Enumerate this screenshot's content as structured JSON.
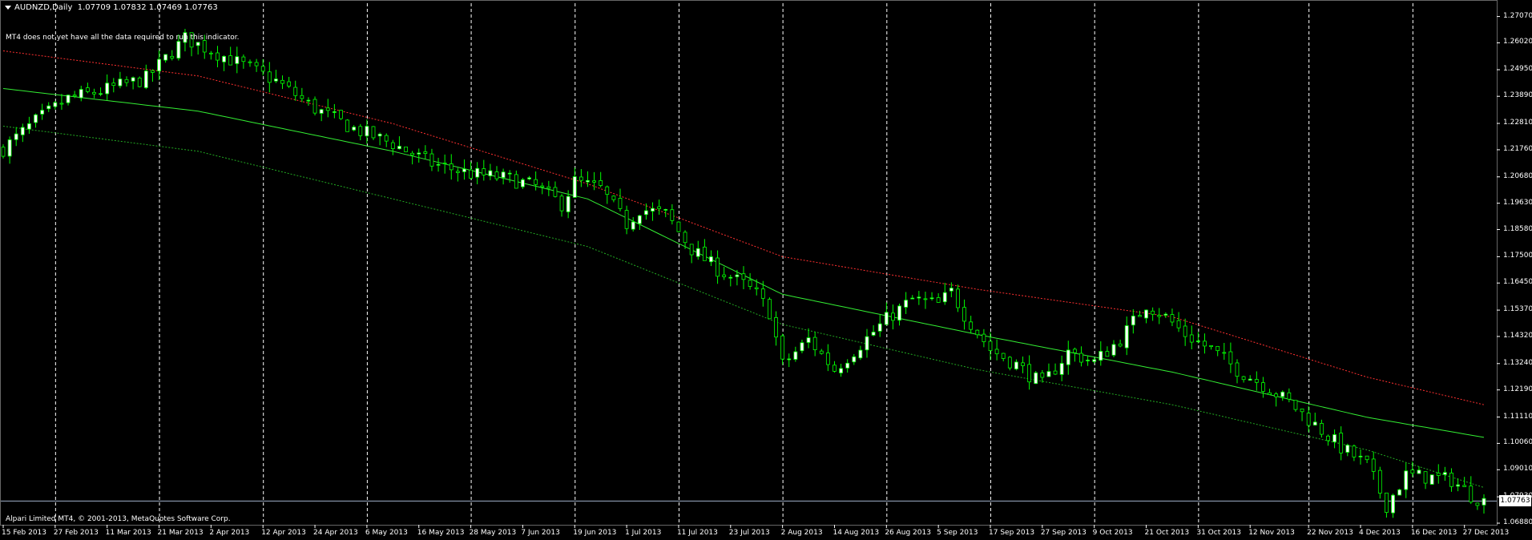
{
  "header": {
    "symbol": "AUDNZD,Daily",
    "ohlc": "1.07709 1.07832 1.07469 1.07763",
    "indicator_message": "MT4 does not yet have all the data required to run this indicator.",
    "copyright": "Alpari Limited MT4, © 2001-2013, MetaQuotes Software Corp.",
    "menu_icon": "triangle-down-icon"
  },
  "colors": {
    "background": "#000000",
    "axis": "#ffffff",
    "grid": "#ffffff",
    "bull_candle": "#ffffff",
    "bear_candle": "#000000",
    "wick": "#00ff00",
    "upper_band": "#ff3030",
    "middle_line": "#33ee33",
    "lower_band": "#22aa22",
    "bid_line": "#9fb0c8"
  },
  "chart_data": {
    "type": "candlestick",
    "symbol": "AUDNZD",
    "timeframe": "Daily",
    "current_price": "1.07763",
    "y_ticks": [
      "1.27070",
      "1.26020",
      "1.24950",
      "1.23890",
      "1.22810",
      "1.21760",
      "1.20680",
      "1.19630",
      "1.18580",
      "1.17500",
      "1.16450",
      "1.15370",
      "1.14320",
      "1.13240",
      "1.12190",
      "1.11110",
      "1.10060",
      "1.09010",
      "1.07930",
      "1.06880"
    ],
    "ylim": [
      1.0688,
      1.276
    ],
    "x_ticks": [
      "15 Feb 2013",
      "27 Feb 2013",
      "11 Mar 2013",
      "21 Mar 2013",
      "2 Apr 2013",
      "12 Apr 2013",
      "24 Apr 2013",
      "6 May 2013",
      "16 May 2013",
      "28 May 2013",
      "7 Jun 2013",
      "19 Jun 2013",
      "1 Jul 2013",
      "11 Jul 2013",
      "23 Jul 2013",
      "2 Aug 2013",
      "14 Aug 2013",
      "26 Aug 2013",
      "5 Sep 2013",
      "17 Sep 2013",
      "27 Sep 2013",
      "9 Oct 2013",
      "21 Oct 2013",
      "31 Oct 2013",
      "12 Nov 2013",
      "22 Nov 2013",
      "4 Dec 2013",
      "16 Dec 2013",
      "27 Dec 2013"
    ],
    "vertical_grid_at": [
      "27 Feb 2013",
      "21 Mar 2013",
      "12 Apr 2013",
      "6 May 2013",
      "28 May 2013",
      "19 Jun 2013",
      "11 Jul 2013",
      "2 Aug 2013",
      "26 Aug 2013",
      "17 Sep 2013",
      "9 Oct 2013",
      "31 Oct 2013",
      "22 Nov 2013",
      "16 Dec 2013"
    ],
    "bar_count": 229,
    "close_path": [
      [
        0,
        1.218
      ],
      [
        5,
        1.229
      ],
      [
        10,
        1.238
      ],
      [
        15,
        1.241
      ],
      [
        22,
        1.246
      ],
      [
        28,
        1.262
      ],
      [
        33,
        1.256
      ],
      [
        38,
        1.25
      ],
      [
        42,
        1.245
      ],
      [
        48,
        1.234
      ],
      [
        54,
        1.226
      ],
      [
        60,
        1.22
      ],
      [
        66,
        1.212
      ],
      [
        72,
        1.208
      ],
      [
        78,
        1.206
      ],
      [
        82,
        1.203
      ],
      [
        86,
        1.196
      ],
      [
        88,
        1.205
      ],
      [
        92,
        1.202
      ],
      [
        96,
        1.188
      ],
      [
        98,
        1.194
      ],
      [
        102,
        1.192
      ],
      [
        106,
        1.178
      ],
      [
        110,
        1.17
      ],
      [
        114,
        1.164
      ],
      [
        116,
        1.16
      ],
      [
        118,
        1.153
      ],
      [
        120,
        1.132
      ],
      [
        124,
        1.142
      ],
      [
        128,
        1.13
      ],
      [
        132,
        1.14
      ],
      [
        136,
        1.15
      ],
      [
        140,
        1.158
      ],
      [
        144,
        1.156
      ],
      [
        146,
        1.161
      ],
      [
        148,
        1.152
      ],
      [
        152,
        1.138
      ],
      [
        156,
        1.132
      ],
      [
        160,
        1.124
      ],
      [
        164,
        1.137
      ],
      [
        168,
        1.133
      ],
      [
        172,
        1.142
      ],
      [
        176,
        1.156
      ],
      [
        179,
        1.151
      ],
      [
        182,
        1.144
      ],
      [
        186,
        1.138
      ],
      [
        190,
        1.13
      ],
      [
        194,
        1.124
      ],
      [
        198,
        1.117
      ],
      [
        202,
        1.108
      ],
      [
        206,
        1.099
      ],
      [
        210,
        1.092
      ],
      [
        213,
        1.076
      ],
      [
        216,
        1.088
      ],
      [
        220,
        1.087
      ],
      [
        223,
        1.086
      ],
      [
        226,
        1.08
      ],
      [
        228,
        1.0776
      ]
    ],
    "middle_line": [
      [
        0,
        1.242
      ],
      [
        30,
        1.233
      ],
      [
        60,
        1.217
      ],
      [
        90,
        1.198
      ],
      [
        120,
        1.16
      ],
      [
        150,
        1.144
      ],
      [
        180,
        1.129
      ],
      [
        210,
        1.111
      ],
      [
        228,
        1.103
      ]
    ],
    "upper_band": [
      [
        0,
        1.257
      ],
      [
        30,
        1.247
      ],
      [
        60,
        1.228
      ],
      [
        90,
        1.204
      ],
      [
        120,
        1.175
      ],
      [
        150,
        1.162
      ],
      [
        180,
        1.151
      ],
      [
        210,
        1.127
      ],
      [
        228,
        1.116
      ]
    ],
    "lower_band": [
      [
        0,
        1.227
      ],
      [
        30,
        1.217
      ],
      [
        60,
        1.198
      ],
      [
        90,
        1.179
      ],
      [
        120,
        1.148
      ],
      [
        150,
        1.13
      ],
      [
        180,
        1.116
      ],
      [
        210,
        1.098
      ],
      [
        228,
        1.083
      ]
    ]
  }
}
